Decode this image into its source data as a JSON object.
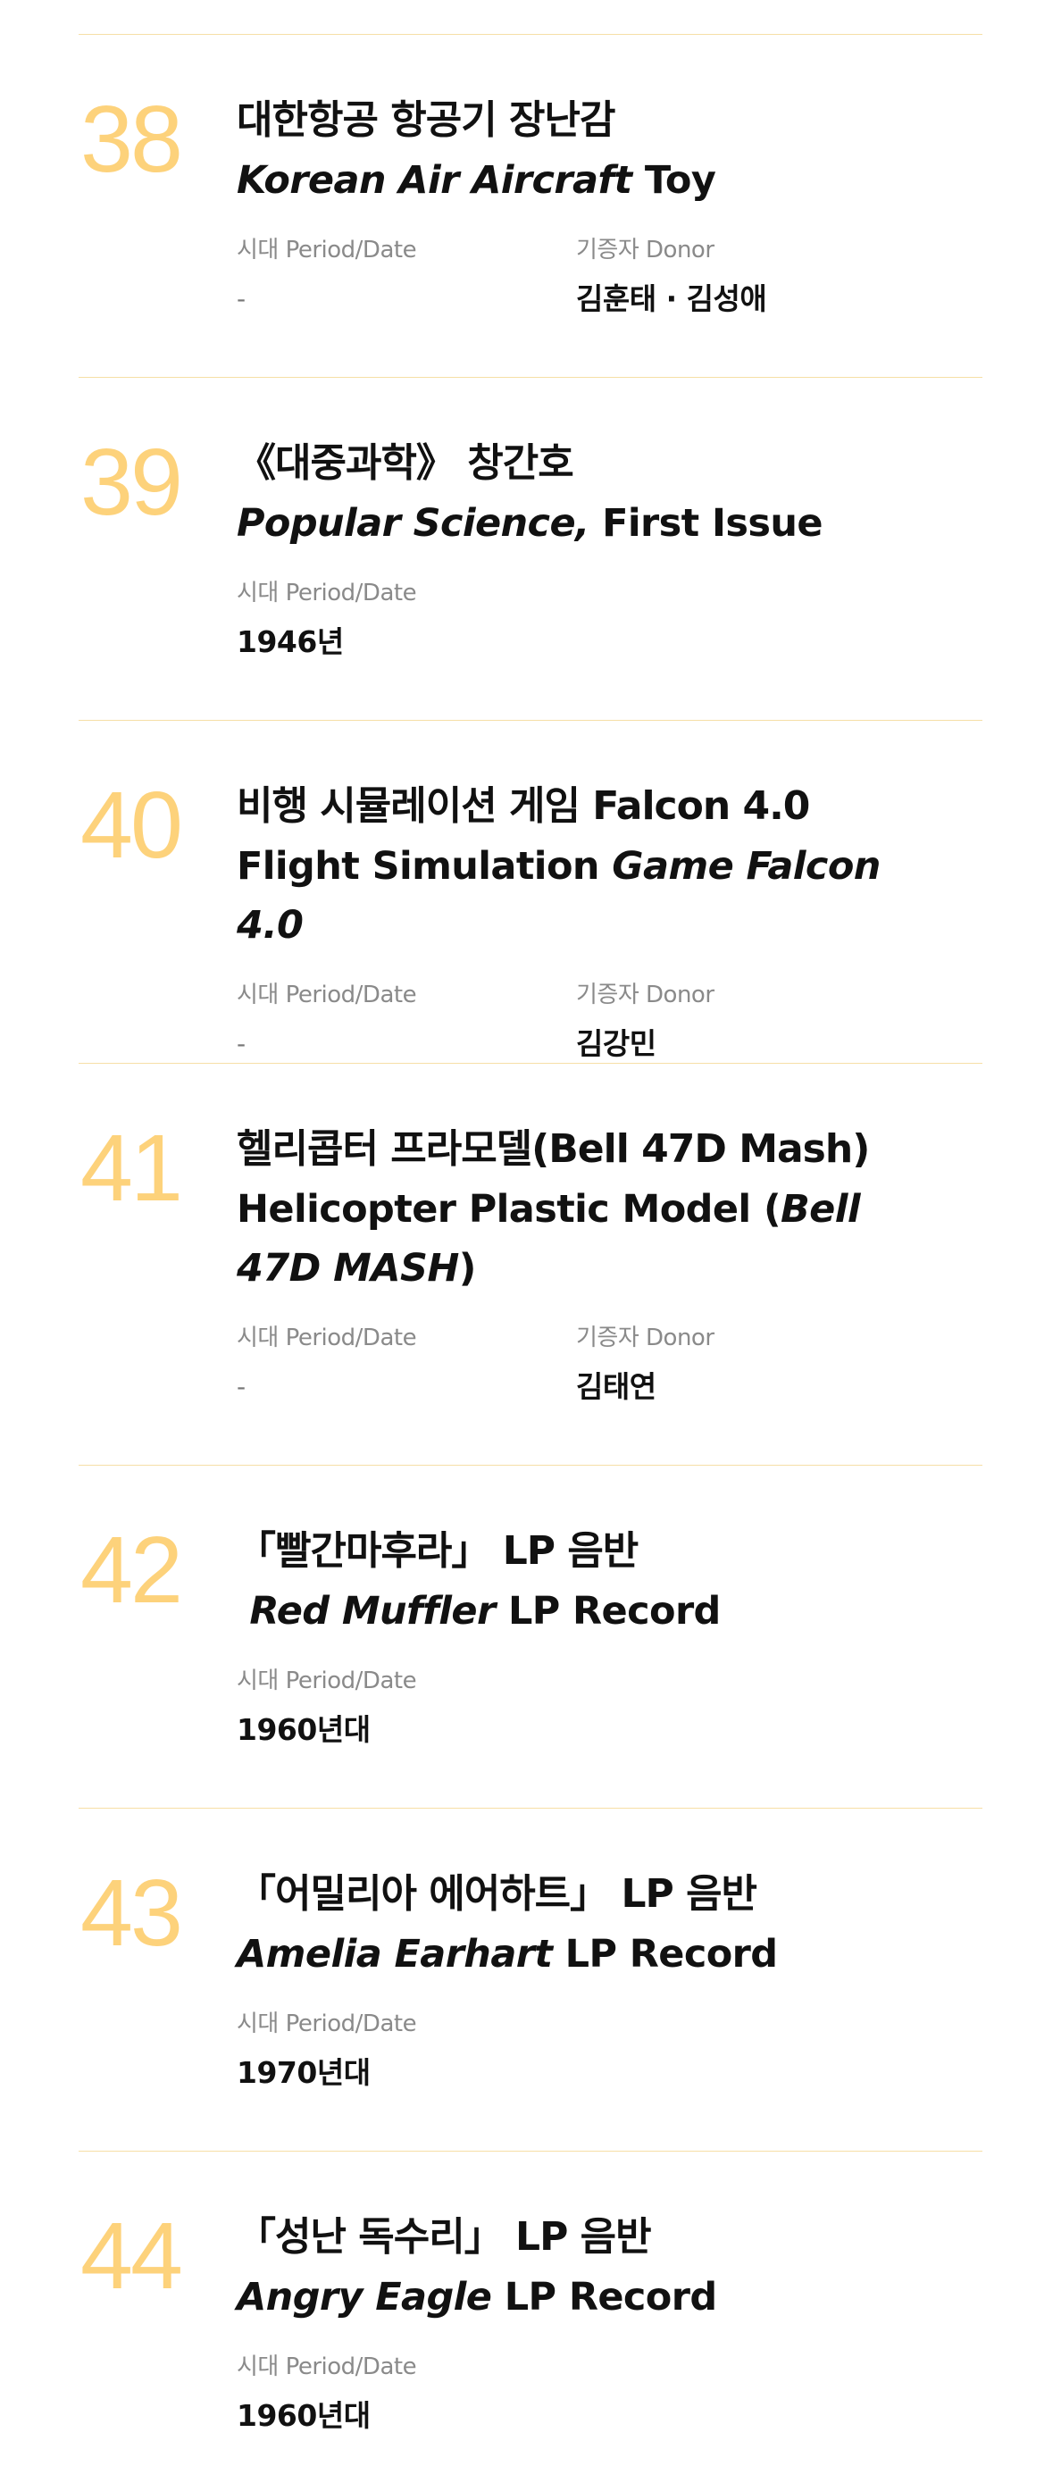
{
  "items": [
    {
      "number": "38",
      "title_ko": "대한항공 항공기 장난감",
      "title_en": [
        {
          "text": "Korean Air Aircraft",
          "italic": true
        },
        {
          "text": " Toy",
          "italic": false
        }
      ],
      "period_label": "시대 Period/Date",
      "period": "-",
      "donor_label": "기증자 Donor",
      "donor": "김훈태 · 김성애"
    },
    {
      "number": "39",
      "title_ko": "《대중과학》 창간호",
      "title_en": [
        {
          "text": "Popular Science,",
          "italic": true
        },
        {
          "text": " First Issue",
          "italic": false
        }
      ],
      "period_label": "시대 Period/Date",
      "period": "1946년"
    },
    {
      "number": "40",
      "title_ko": "비행 시뮬레이션 게임 Falcon 4.0",
      "title_en": [
        {
          "text": "Flight Simulation ",
          "italic": false
        },
        {
          "text": "Game Falcon 4.0",
          "italic": true
        }
      ],
      "period_label": "시대 Period/Date",
      "period": "-",
      "donor_label": "기증자 Donor",
      "donor": "김강민"
    },
    {
      "number": "41",
      "title_ko": "헬리콥터 프라모델(Bell 47D Mash)",
      "title_en": [
        {
          "text": "Helicopter Plastic Model (",
          "italic": false
        },
        {
          "text": "Bell 47D MASH",
          "italic": true
        },
        {
          "text": ")",
          "italic": false
        }
      ],
      "period_label": "시대 Period/Date",
      "period": "-",
      "donor_label": "기증자 Donor",
      "donor": "김태연"
    },
    {
      "number": "42",
      "title_ko": "「빨간마후라」 LP 음반",
      "title_en": [
        {
          "text": " Red Muffler",
          "italic": true
        },
        {
          "text": " LP Record",
          "italic": false
        }
      ],
      "period_label": "시대 Period/Date",
      "period": "1960년대"
    },
    {
      "number": "43",
      "title_ko": "「어밀리아 에어하트」 LP 음반",
      "title_en": [
        {
          "text": "Amelia Earhart",
          "italic": true
        },
        {
          "text": " LP Record",
          "italic": false
        }
      ],
      "period_label": "시대 Period/Date",
      "period": "1970년대"
    },
    {
      "number": "44",
      "title_ko": "「성난 독수리」 LP 음반",
      "title_en": [
        {
          "text": "Angry Eagle",
          "italic": true
        },
        {
          "text": " LP Record",
          "italic": false
        }
      ],
      "period_label": "시대 Period/Date",
      "period": "1960년대"
    }
  ]
}
